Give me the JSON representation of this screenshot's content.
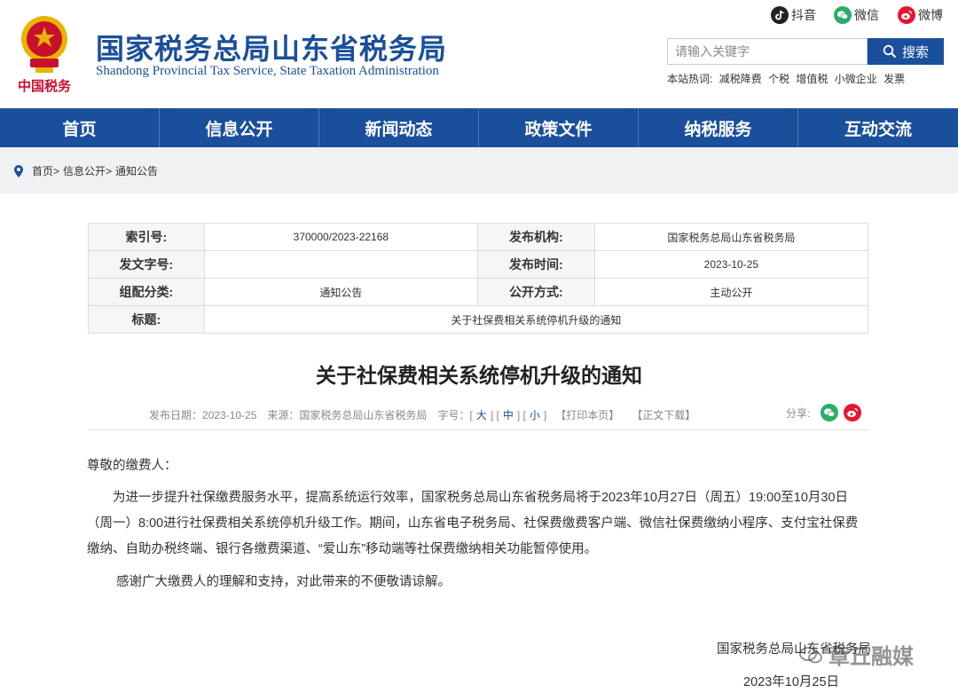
{
  "header": {
    "title": "国家税务总局山东省税务局",
    "subtitle": "Shandong Provincial Tax Service, State Taxation Administration",
    "emblem_text": "中国税务",
    "social": [
      {
        "label": "抖音",
        "icon": "douyin-icon",
        "color": "#222222"
      },
      {
        "label": "微信",
        "icon": "wechat-icon",
        "color": "#2aae67"
      },
      {
        "label": "微博",
        "icon": "weibo-icon",
        "color": "#e6162d"
      }
    ],
    "search_placeholder": "请输入关键字",
    "search_button": "搜索",
    "hot_label": "本站热词:",
    "hot_words": [
      "减税降费",
      "个税",
      "增值税",
      "小微企业",
      "发票"
    ]
  },
  "nav": [
    "首页",
    "信息公开",
    "新闻动态",
    "政策文件",
    "纳税服务",
    "互动交流"
  ],
  "breadcrumb": {
    "home": "首页>",
    "section": "信息公开>",
    "current": "通知公告"
  },
  "meta": {
    "index_label": "索引号:",
    "index_value": "370000/2023-22168",
    "org_label": "发布机构:",
    "org_value": "国家税务总局山东省税务局",
    "doc_label": "发文字号:",
    "doc_value": "",
    "date_label": "发布时间:",
    "date_value": "2023-10-25",
    "category_label": "组配分类:",
    "category_value": "通知公告",
    "mode_label": "公开方式:",
    "mode_value": "主动公开",
    "title_label": "标题:",
    "title_value": "关于社保费相关系统停机升级的通知"
  },
  "article": {
    "title": "关于社保费相关系统停机升级的通知",
    "date_label": "发布日期：",
    "date": "2023-10-25",
    "source_label": "来源：",
    "source": "国家税务总局山东省税务局",
    "font_label": "字号：",
    "font_large": "大",
    "font_medium": "中",
    "font_small": "小",
    "print": "【打印本页】",
    "download": "【正文下载】",
    "share_label": "分享:",
    "greeting": "尊敬的缴费人：",
    "para1": "为进一步提升社保缴费服务水平，提高系统运行效率，国家税务总局山东省税务局将于2023年10月27日（周五）19:00至10月30日（周一）8:00进行社保费相关系统停机升级工作。期间，山东省电子税务局、社保费缴费客户端、微信社保费缴纳小程序、支付宝社保费缴纳、自助办税终端、银行各缴费渠道、“爱山东”移动端等社保费缴纳相关功能暂停使用。",
    "para2": "感谢广大缴费人的理解和支持，对此带来的不便敬请谅解。",
    "signature": "国家税务总局山东省税务局",
    "sign_date": "2023年10月25日"
  },
  "watermark": "章丘融媒",
  "colors": {
    "brand_blue": "#1a4f9c",
    "emblem_red": "#c8102e",
    "emblem_gold": "#e8b400"
  }
}
